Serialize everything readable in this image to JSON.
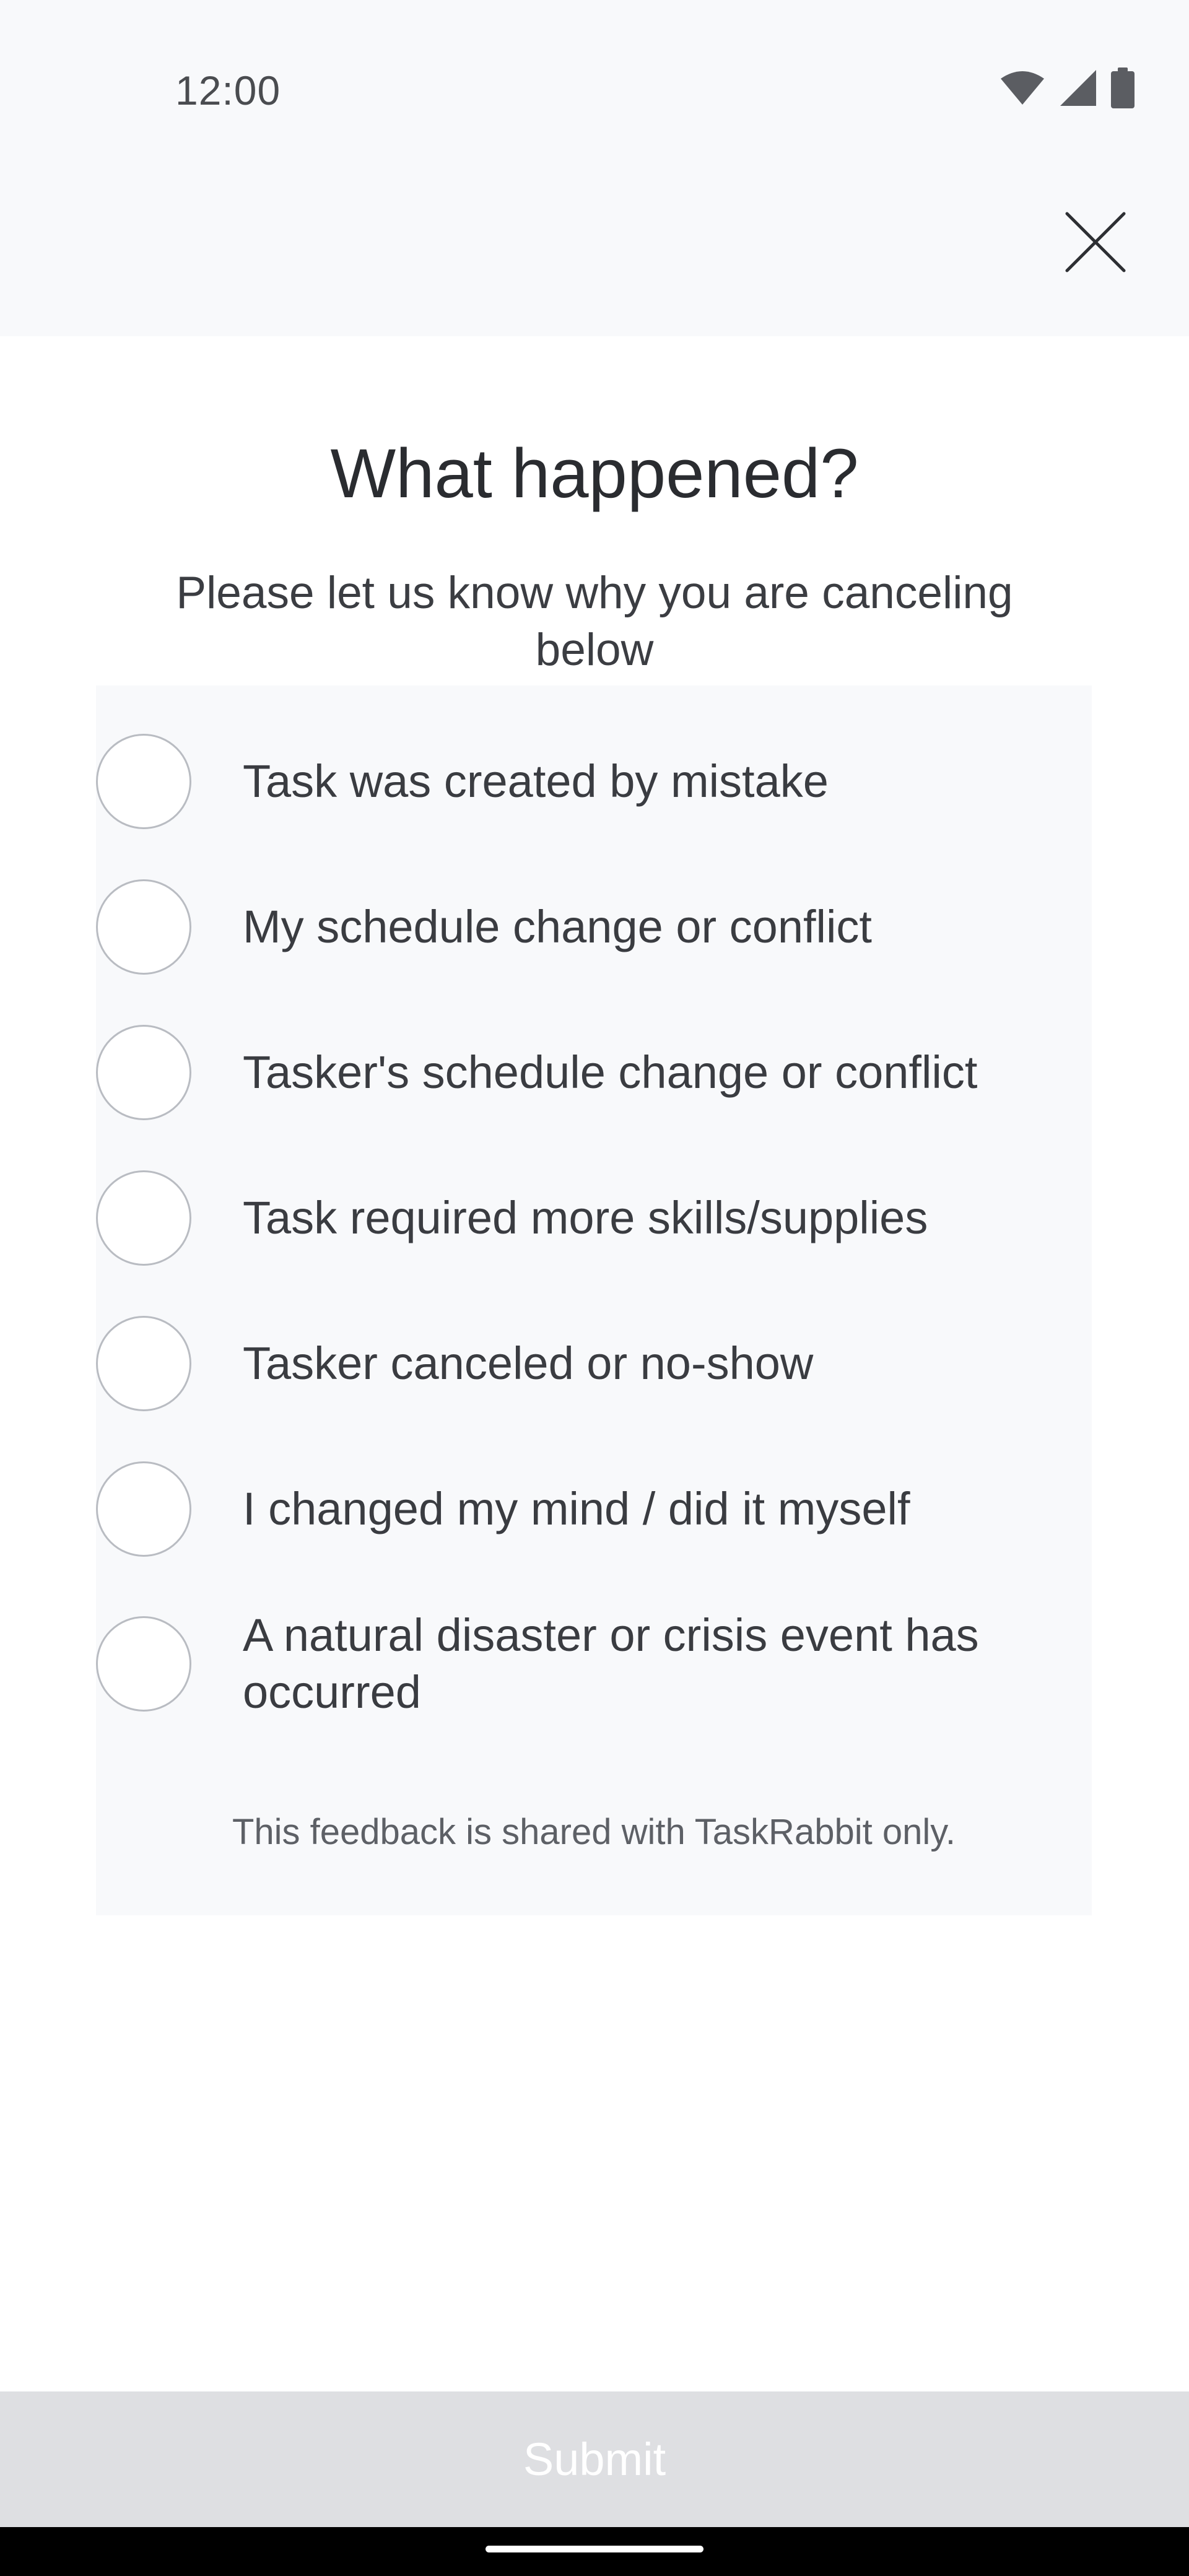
{
  "status_bar": {
    "time": "12:00",
    "icons": [
      "wifi-icon",
      "cellular-signal-icon",
      "battery-icon"
    ]
  },
  "header": {
    "close_icon": "close-icon"
  },
  "main": {
    "title": "What happened?",
    "subtitle": "Please let us know why you are canceling below",
    "options": [
      {
        "label": "Task was created by mistake",
        "selected": false
      },
      {
        "label": "My schedule change or conflict",
        "selected": false
      },
      {
        "label": "Tasker's schedule change or conflict",
        "selected": false
      },
      {
        "label": "Task required more skills/supplies",
        "selected": false
      },
      {
        "label": "Tasker canceled or no-show",
        "selected": false
      },
      {
        "label": "I changed my mind / did it myself",
        "selected": false
      },
      {
        "label": "A natural disaster or crisis event has occurred",
        "selected": false
      }
    ],
    "footer_note": "This feedback is shared with TaskRabbit only."
  },
  "submit": {
    "label": "Submit",
    "enabled": false
  },
  "colors": {
    "header_background": "#f8f9fb",
    "panel_background": "#f8f9fb",
    "submit_disabled_background": "#dedfe2",
    "radio_border": "#b9bcc2",
    "text_primary": "#2a2c30"
  }
}
